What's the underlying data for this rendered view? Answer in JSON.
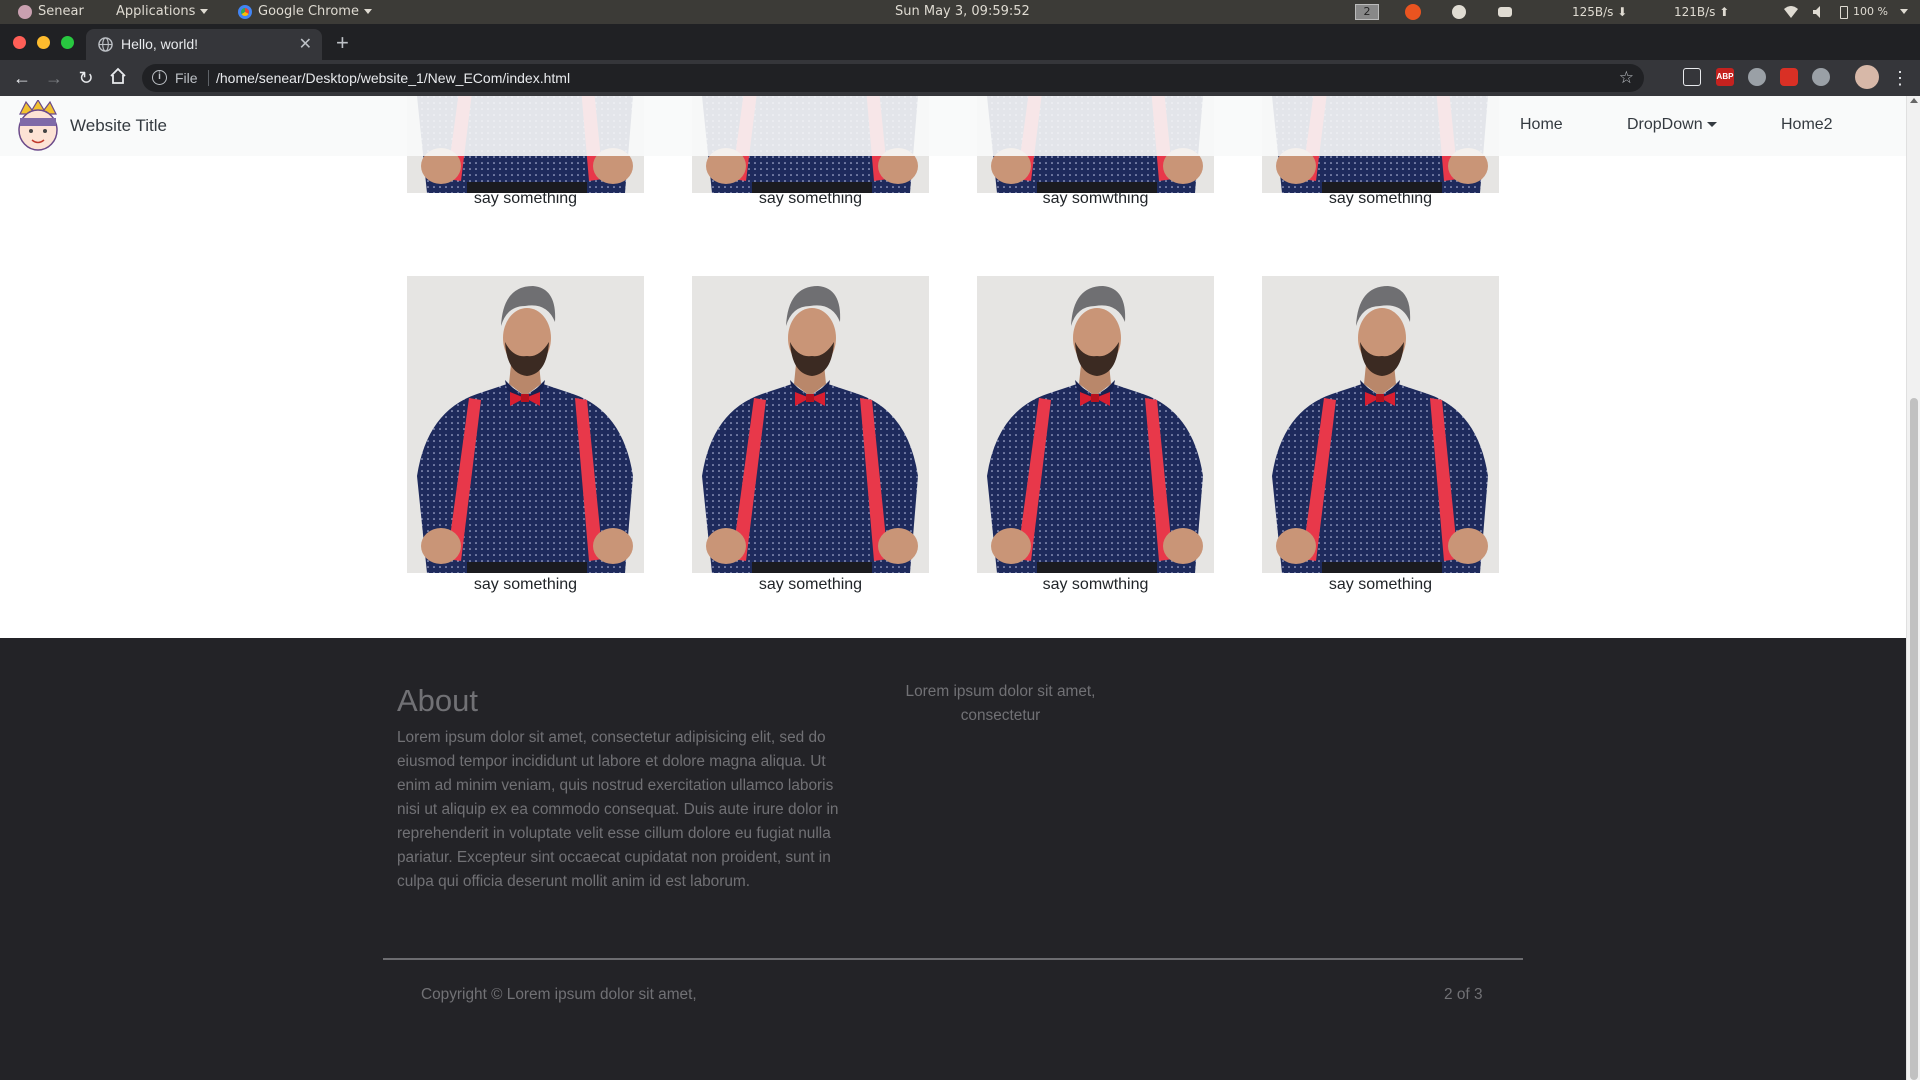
{
  "os_panel": {
    "user": "Senear",
    "apps_menu": "Applications",
    "active_app": "Google Chrome",
    "clock": "Sun May  3, 09:59:52",
    "workspace": "2",
    "net_down": "125B/s",
    "net_up": "121B/s",
    "battery": "100 %"
  },
  "browser": {
    "tab_title": "Hello, world!",
    "scheme_label": "File",
    "url": "/home/senear/Desktop/website_1/New_ECom/index.html",
    "ext_abp": "ABP"
  },
  "site": {
    "brand": "Website Title",
    "nav": {
      "home": "Home",
      "dropdown": "DropDown",
      "home2": "Home2"
    },
    "products_row1": [
      {
        "caption": "say something"
      },
      {
        "caption": "say something"
      },
      {
        "caption": "say somwthing"
      },
      {
        "caption": "say something"
      }
    ],
    "products_row2": [
      {
        "caption": "say something"
      },
      {
        "caption": "say something"
      },
      {
        "caption": "say somwthing"
      },
      {
        "caption": "say something"
      }
    ],
    "footer": {
      "about_heading": "About",
      "about_text": "Lorem ipsum dolor sit amet, consectetur adipisicing elit, sed do eiusmod tempor incididunt ut labore et dolore magna aliqua. Ut enim ad minim veniam, quis nostrud exercitation ullamco laboris nisi ut aliquip ex ea commodo consequat. Duis aute irure dolor in reprehenderit in voluptate velit esse cillum dolore eu fugiat nulla pariatur. Excepteur sint occaecat cupidatat non proident, sunt in culpa qui officia deserunt mollit anim id est laborum.",
      "mid_text": "Lorem ipsum dolor sit amet, consectetur",
      "copyright": "Copyright © Lorem ipsum dolor sit amet,",
      "page_indicator": "2 of 3"
    }
  },
  "colors": {
    "footer_bg": "#232327",
    "footer_text": "#717175",
    "suspender_red": "#e8384a",
    "shirt_navy": "#1e2a5c"
  }
}
